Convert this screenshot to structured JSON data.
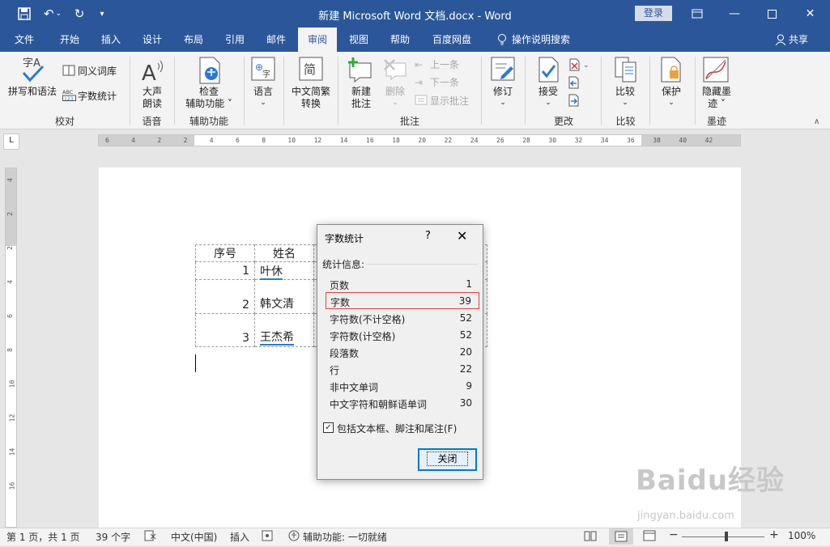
{
  "window": {
    "title": "新建 Microsoft Word 文档.docx  -  Word",
    "login_label": "登录",
    "qat": {
      "customize_glyph": "▾"
    }
  },
  "tabs": [
    "文件",
    "开始",
    "插入",
    "设计",
    "布局",
    "引用",
    "邮件",
    "审阅",
    "视图",
    "帮助",
    "百度网盘"
  ],
  "active_tab": "审阅",
  "tell_me": "操作说明搜索",
  "share_label": "共享",
  "ribbon": {
    "proofing": {
      "spelling": "拼写和语法",
      "thesaurus": "同义词库",
      "wordcount": "字数统计",
      "group": "校对"
    },
    "speech": {
      "read_aloud_1": "大声",
      "read_aloud_2": "朗读",
      "group": "语音"
    },
    "accessibility": {
      "check_1": "检查",
      "check_2": "辅助功能 ˅",
      "group": "辅助功能"
    },
    "language": {
      "language": "语言"
    },
    "chinese": {
      "conv_1": "中文简繁",
      "conv_2": "转换"
    },
    "comments": {
      "new_1": "新建",
      "new_2": "批注",
      "delete": "删除",
      "prev": "上一条",
      "next": "下一条",
      "show": "显示批注",
      "group": "批注"
    },
    "tracking": {
      "track": "修订"
    },
    "changes": {
      "accept": "接受",
      "group": "更改"
    },
    "compare": {
      "compare": "比较",
      "group": "比较"
    },
    "protect": {
      "protect": "保护"
    },
    "ink": {
      "hide_1": "隐藏墨",
      "hide_2": "迹 ˅",
      "group": "墨迹"
    }
  },
  "ruler": {
    "tabsel": "L",
    "ticks": [
      "6",
      "4",
      "2",
      "2",
      "4",
      "6",
      "8",
      "10",
      "12",
      "14",
      "16",
      "18",
      "20",
      "22",
      "24",
      "26",
      "28",
      "30",
      "32",
      "34",
      "36",
      "38",
      "40",
      "42"
    ],
    "vticks": [
      "4",
      "2",
      "2",
      "4",
      "6",
      "8",
      "10",
      "12",
      "14",
      "16"
    ]
  },
  "document": {
    "table": {
      "headers": [
        "序号",
        "姓名"
      ],
      "rows": [
        [
          "1",
          "叶休"
        ],
        [
          "2",
          "韩文清"
        ],
        [
          "3",
          "王杰希"
        ]
      ]
    }
  },
  "dialog": {
    "title": "字数统计",
    "help": "?",
    "section": "统计信息:",
    "stats": [
      {
        "label": "页数",
        "value": "1"
      },
      {
        "label": "字数",
        "value": "39"
      },
      {
        "label": "字符数(不计空格)",
        "value": "52"
      },
      {
        "label": "字符数(计空格)",
        "value": "52"
      },
      {
        "label": "段落数",
        "value": "20"
      },
      {
        "label": "行",
        "value": "22"
      },
      {
        "label": "非中文单词",
        "value": "9"
      },
      {
        "label": "中文字符和朝鲜语单词",
        "value": "30"
      }
    ],
    "checkbox_label": "包括文本框、脚注和尾注(F)",
    "checkbox_checked": true,
    "close_button": "关闭"
  },
  "status": {
    "page": "第 1 页，共 1 页",
    "words": "39 个字",
    "language": "中文(中国)",
    "mode": "插入",
    "accessibility": "辅助功能: 一切就绪",
    "zoom": "100%"
  },
  "watermark": {
    "brand": "Baidu经验",
    "url": "jingyan.baidu.com"
  }
}
